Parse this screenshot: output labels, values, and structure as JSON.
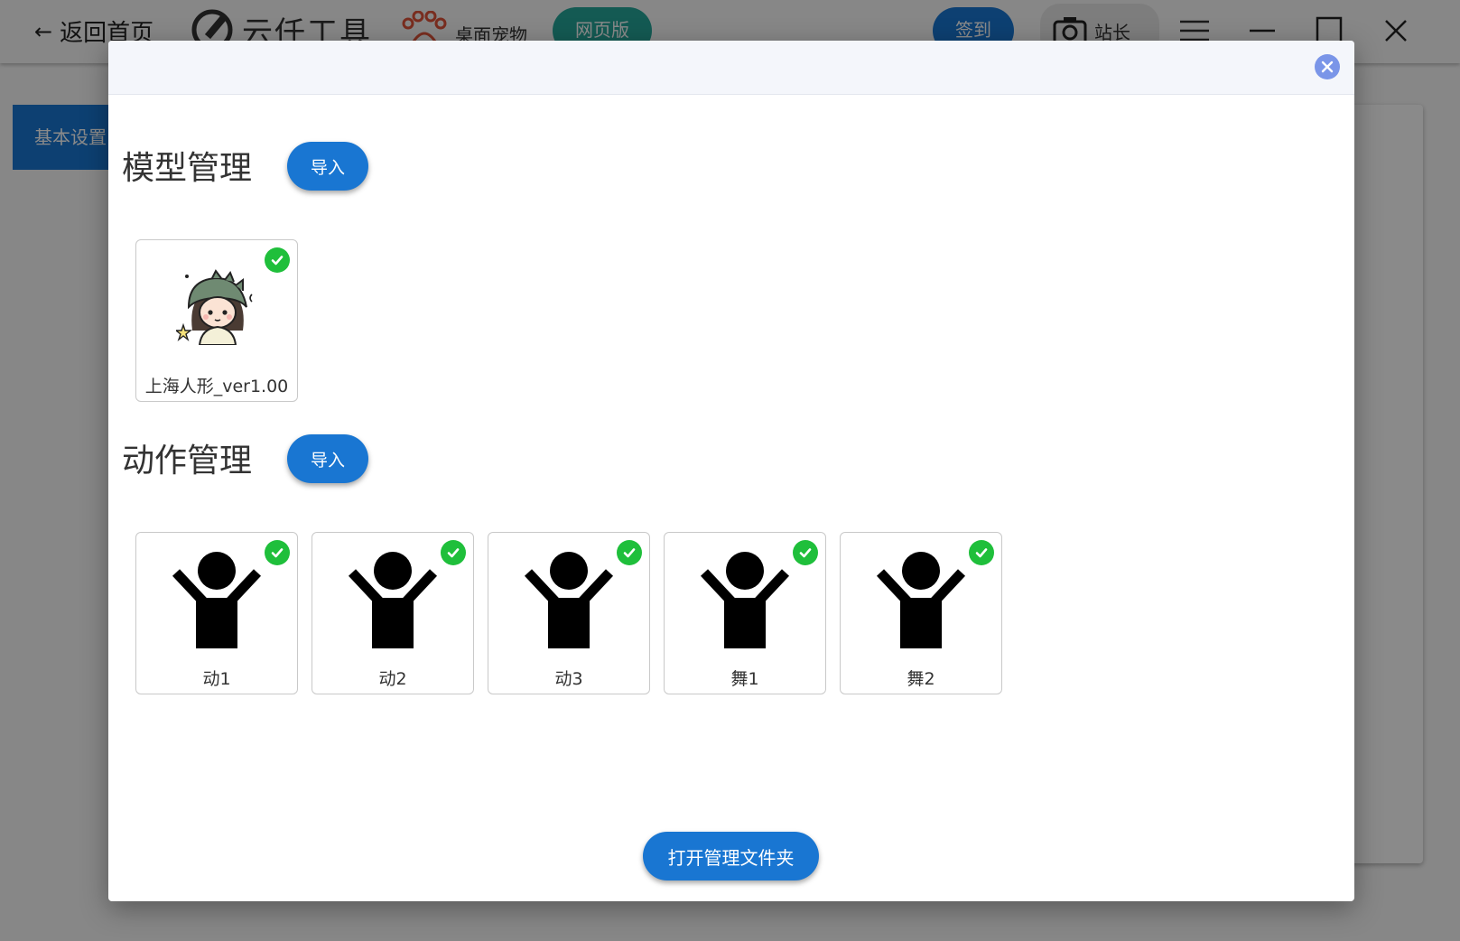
{
  "topbar": {
    "back_label": "返回首页",
    "app_name": "云仟工具",
    "pet_label": "桌面宠物",
    "web_label": "网页版",
    "checkin_label": "签到",
    "admin_label": "站长"
  },
  "sidebar": {
    "active_tab": "基本设置"
  },
  "dialog": {
    "model_section": {
      "title": "模型管理",
      "import_label": "导入",
      "items": [
        {
          "name": "上海人形_ver1.00",
          "selected": true,
          "icon": "anime-girl-avatar"
        }
      ]
    },
    "motion_section": {
      "title": "动作管理",
      "import_label": "导入",
      "items": [
        {
          "name": "动1",
          "selected": true,
          "icon": "person-arms-up-icon"
        },
        {
          "name": "动2",
          "selected": true,
          "icon": "person-arms-up-icon"
        },
        {
          "name": "动3",
          "selected": true,
          "icon": "person-arms-up-icon"
        },
        {
          "name": "舞1",
          "selected": true,
          "icon": "person-arms-up-icon"
        },
        {
          "name": "舞2",
          "selected": true,
          "icon": "person-arms-up-icon"
        }
      ]
    },
    "open_folder_label": "打开管理文件夹"
  },
  "colors": {
    "primary": "#1976d2",
    "teal": "#26a69a",
    "check_green": "#1fbf3b",
    "close_blue": "#7a95e8"
  }
}
